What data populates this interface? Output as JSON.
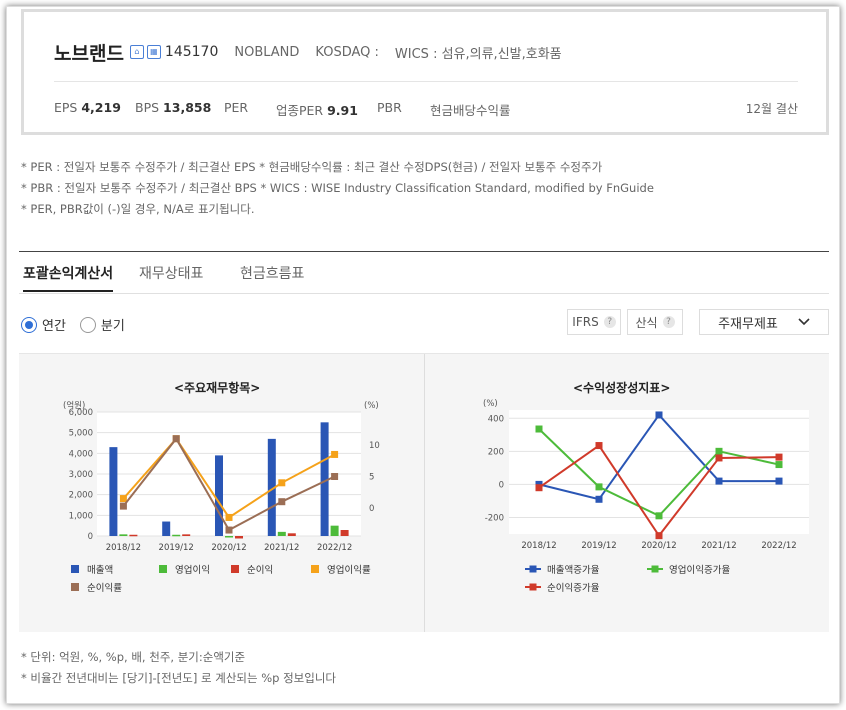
{
  "company": {
    "name": "노브랜드",
    "code": "145170",
    "eng": "NOBLAND",
    "market": "KOSDAQ :",
    "wics": "WICS : 섬유,의류,신발,호화품",
    "icon1": "home-icon",
    "icon2": "building-icon"
  },
  "indicators": {
    "eps_label": "EPS",
    "eps_value": "4,219",
    "bps_label": "BPS",
    "bps_value": "13,858",
    "per_label": "PER",
    "ind_per_label": "업종PER",
    "ind_per_value": "9.91",
    "pbr_label": "PBR",
    "div_label": "현금배당수익률",
    "settle": "12월 결산"
  },
  "notes": [
    "* PER : 전일자 보통주 수정주가 / 최근결산 EPS * 현금배당수익률 : 최근 결산 수정DPS(현금) / 전일자 보통주 수정주가",
    "* PBR : 전일자 보통주 수정주가 / 최근결산 BPS * WICS : WISE Industry Classification Standard, modified by FnGuide",
    "* PER, PBR값이 (-)일 경우, N/A로 표기됩니다."
  ],
  "tabs": [
    "포괄손익계산서",
    "재무상태표",
    "현금흐름표"
  ],
  "period": {
    "annual": "연간",
    "quarter": "분기"
  },
  "controls": {
    "ifrs": "IFRS",
    "calc": "산식",
    "statement": "주재무제표",
    "help": "?"
  },
  "chart_titles": {
    "left": "<주요재무항목>",
    "right": "<수익성장성지표>"
  },
  "footnotes": [
    "* 단위: 억원, %, %p, 배, 천주, 분기:순액기준",
    "* 비율간 전년대비는 [당기]-[전년도] 로 계산되는 %p 정보입니다"
  ],
  "chart_data": [
    {
      "type": "bar",
      "title": "<주요재무항목>",
      "ylabel": "(억원)",
      "y2label": "(%)",
      "categories": [
        "2018/12",
        "2019/12",
        "2020/12",
        "2021/12",
        "2022/12"
      ],
      "ylim": [
        0,
        5000
      ],
      "yticks": [
        "0",
        "1,000",
        "2,000",
        "3,000",
        "4,000",
        "5,000",
        "6,000"
      ],
      "y2lim": [
        -5,
        12
      ],
      "y2ticks": [
        "0",
        "5",
        "10"
      ],
      "series": [
        {
          "name": "매출액",
          "kind": "bar",
          "axis": "left",
          "color": "#2a56b5",
          "values": [
            4300,
            700,
            3900,
            4700,
            5500
          ]
        },
        {
          "name": "영업이익",
          "kind": "bar",
          "axis": "left",
          "color": "#4dbb3a",
          "values": [
            80,
            60,
            -40,
            200,
            500
          ]
        },
        {
          "name": "순이익",
          "kind": "bar",
          "axis": "left",
          "color": "#d03a2a",
          "values": [
            60,
            80,
            -120,
            130,
            290
          ]
        },
        {
          "name": "영업이익률",
          "kind": "line",
          "axis": "right",
          "color": "#f5a21a",
          "values": [
            1.5,
            11,
            -1.5,
            4,
            8.5
          ]
        },
        {
          "name": "순이익률",
          "kind": "line",
          "axis": "right",
          "color": "#9b6e55",
          "values": [
            0.3,
            11,
            -3.5,
            1,
            5
          ]
        }
      ],
      "grid": true,
      "legend": "bottom"
    },
    {
      "type": "line",
      "title": "<수익성장성지표>",
      "ylabel": "(%)",
      "categories": [
        "2018/12",
        "2019/12",
        "2020/12",
        "2021/12",
        "2022/12"
      ],
      "ylim": [
        -300,
        450
      ],
      "yticks": [
        "-200",
        "0",
        "200",
        "400"
      ],
      "series": [
        {
          "name": "매출액증가율",
          "color": "#2a56b5",
          "values": [
            0,
            -90,
            420,
            20,
            20
          ]
        },
        {
          "name": "영업이익증가율",
          "color": "#4dbb3a",
          "values": [
            335,
            -15,
            -190,
            200,
            120
          ]
        },
        {
          "name": "순이익증가율",
          "color": "#d03a2a",
          "values": [
            -20,
            235,
            -310,
            160,
            165
          ]
        }
      ],
      "grid": true,
      "legend": "bottom"
    }
  ]
}
